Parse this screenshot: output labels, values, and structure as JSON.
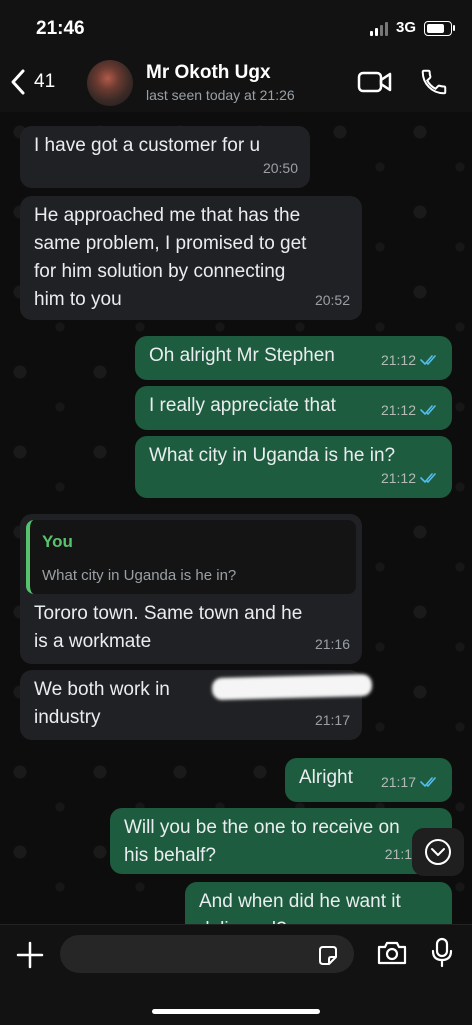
{
  "status_bar": {
    "time": "21:46",
    "network": "3G"
  },
  "header": {
    "back_count": "41",
    "contact_name": "Mr Okoth Ugx",
    "last_seen": "last seen today at 21:26",
    "icons": [
      "back-chevron-icon",
      "video-call-icon",
      "phone-icon"
    ]
  },
  "messages": [
    {
      "direction": "in",
      "text": "I have got a customer for u",
      "time": "20:50"
    },
    {
      "direction": "in",
      "lines": [
        "He approached me that has the",
        "same problem, I promised to get",
        "for him solution by connecting",
        "him to you"
      ],
      "time": "20:52"
    },
    {
      "direction": "out",
      "text": "Oh alright Mr Stephen",
      "time": "21:12",
      "status": "read"
    },
    {
      "direction": "out",
      "text": "I really appreciate that",
      "time": "21:12",
      "status": "read"
    },
    {
      "direction": "out",
      "text": "What city in Uganda is he in?",
      "time": "21:12",
      "status": "read"
    },
    {
      "direction": "in",
      "quote_author": "You",
      "quote_text": "What city in Uganda is he in?",
      "lines": [
        "Tororo town. Same town and he",
        "is a workmate"
      ],
      "time": "21:16"
    },
    {
      "direction": "in",
      "lines": [
        "We both work in",
        "industry"
      ],
      "time": "21:17"
    },
    {
      "direction": "out",
      "text": "Alright",
      "time": "21:17",
      "status": "read"
    },
    {
      "direction": "out",
      "lines": [
        "Will you be the one to receive on",
        "his behalf?"
      ],
      "time": "21:1"
    },
    {
      "direction": "out",
      "lines": [
        "And when did he want it",
        "delivered?"
      ]
    }
  ],
  "input_bar": {
    "icons": [
      "plus-icon",
      "sticker-icon",
      "camera-icon",
      "microphone-icon"
    ]
  },
  "colors": {
    "incoming_bubble": "#202124",
    "outgoing_bubble": "#1e5c3f",
    "read_ticks": "#53bdeb",
    "quote_accent": "#57c46d"
  }
}
